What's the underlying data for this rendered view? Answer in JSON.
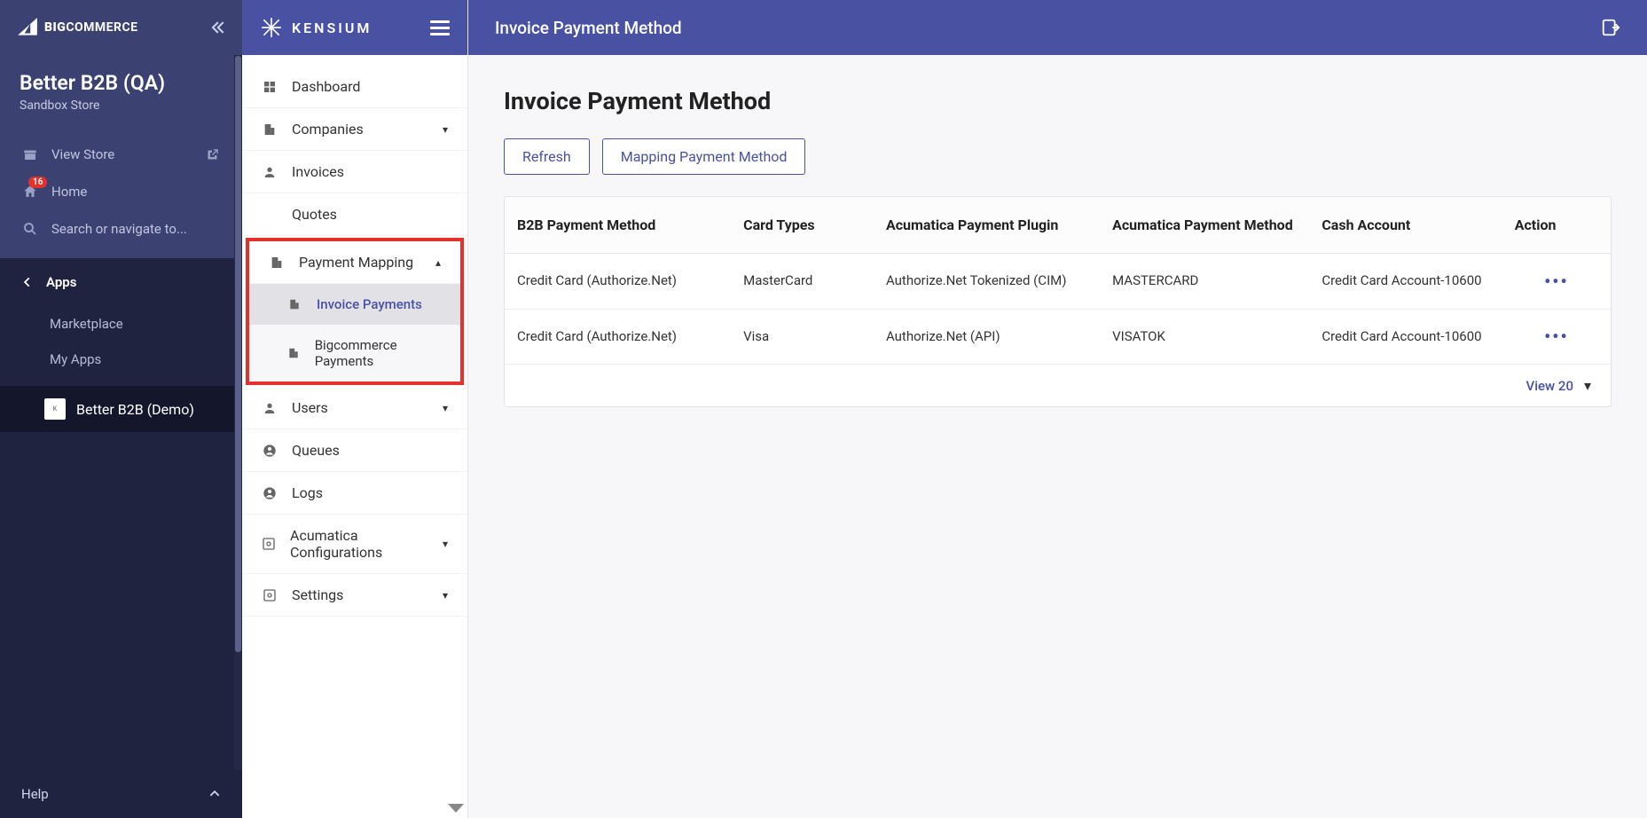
{
  "bc": {
    "brand": "COMMERCE",
    "brandPrefix": "BIG",
    "storeName": "Better B2B (QA)",
    "storeType": "Sandbox Store",
    "viewStore": "View Store",
    "home": "Home",
    "homeBadge": "16",
    "searchPlaceholder": "Search or navigate to...",
    "apps": "Apps",
    "marketplace": "Marketplace",
    "myApps": "My Apps",
    "currentApp": "Better B2B (Demo)",
    "help": "Help"
  },
  "kensium": {
    "brand": "KENSIUM",
    "nav": {
      "dashboard": "Dashboard",
      "companies": "Companies",
      "invoices": "Invoices",
      "quotes": "Quotes",
      "paymentMapping": "Payment Mapping",
      "invoicePayments": "Invoice Payments",
      "bigcommercePayments": "Bigcommerce Payments",
      "users": "Users",
      "queues": "Queues",
      "logs": "Logs",
      "acumaticaConfig": "Acumatica Configurations",
      "settings": "Settings"
    }
  },
  "page": {
    "topTitle": "Invoice Payment Method",
    "heading": "Invoice Payment Method",
    "refresh": "Refresh",
    "mapping": "Mapping Payment Method",
    "viewCount": "View 20"
  },
  "table": {
    "headers": {
      "b2b": "B2B Payment Method",
      "cardTypes": "Card Types",
      "plugin": "Acumatica Payment Plugin",
      "method": "Acumatica Payment Method",
      "cash": "Cash Account",
      "action": "Action"
    },
    "rows": [
      {
        "b2b": "Credit Card (Authorize.Net)",
        "card": "MasterCard",
        "plugin": "Authorize.Net Tokenized (CIM)",
        "method": "MASTERCARD",
        "cash": "Credit Card Account-10600"
      },
      {
        "b2b": "Credit Card (Authorize.Net)",
        "card": "Visa",
        "plugin": "Authorize.Net (API)",
        "method": "VISATOK",
        "cash": "Credit Card Account-10600"
      }
    ]
  }
}
